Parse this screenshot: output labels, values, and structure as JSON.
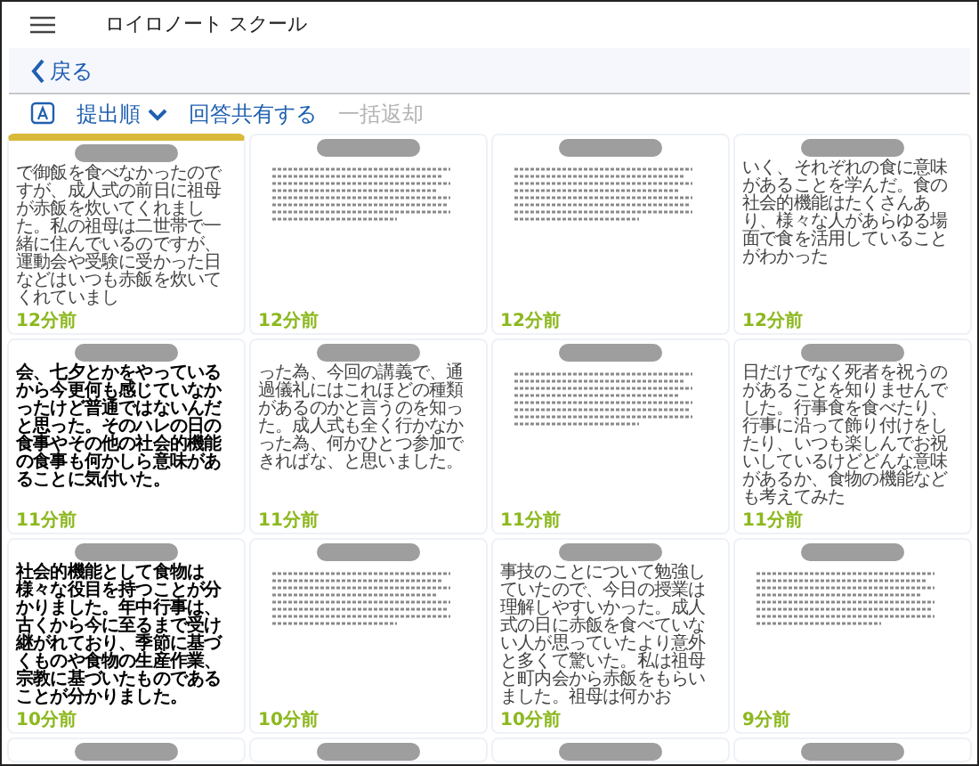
{
  "app_bar": {
    "title": "ロイロノート スクール"
  },
  "nav": {
    "back": "戻る"
  },
  "toolbar": {
    "sort": "提出順",
    "actions": [
      {
        "label": "回答共有する",
        "disabled": false
      },
      {
        "label": "一括返却",
        "disabled": true
      }
    ]
  },
  "cards": [
    {
      "kind": "text",
      "selected": true,
      "body": "で御飯を食べなかったのですが、成人式の前日に祖母が赤飯を炊いてくれました。私の祖母は二世帯で一緒に住んでいるのですが、運動会や受験に受かった日などはいつも赤飯を炊いてくれていまし",
      "time": "12分前"
    },
    {
      "kind": "thumbnail",
      "selected": false,
      "time": "12分前"
    },
    {
      "kind": "thumbnail",
      "selected": false,
      "time": "12分前"
    },
    {
      "kind": "text",
      "selected": false,
      "body": "いく、それぞれの食に意味があることを学んだ。食の社会的機能はたくさんあり、様々な人があらゆる場面で食を活用していることがわかった",
      "time": "12分前"
    },
    {
      "kind": "bold",
      "selected": false,
      "body": "会、七夕とかをやっているから今更何も感じていなかったけど普通ではないんだと思った。そのハレの日の食事やその他の社会的機能の食事も何かしら意味があることに気付いた。",
      "time": "11分前"
    },
    {
      "kind": "text",
      "selected": false,
      "body": "った為、今回の講義で、通過儀礼にはこれほどの種類があるのかと言うのを知った。成人式も全く行かなかった為、何かひとつ参加できればな、と思いました。",
      "time": "11分前"
    },
    {
      "kind": "thumbnail",
      "selected": false,
      "time": "11分前"
    },
    {
      "kind": "text",
      "selected": false,
      "body": "日だけでなく死者を祝うのがあることを知りませんでした。行事食を食べたり、行事に沿って飾り付けをしたり、いつも楽しんでお祝いしているけどどんな意味があるか、食物の機能なども考えてみた",
      "time": "11分前"
    },
    {
      "kind": "handwriting",
      "selected": false,
      "body": "社会的機能として食物は様々な役目を持つことが分かりました。年中行事は、古くから今に至るまで受け継がれており、季節に基づくものや食物の生産作業、宗教に基づいたものであることが分かりました。",
      "time": "10分前"
    },
    {
      "kind": "thumbnail",
      "selected": false,
      "time": "10分前"
    },
    {
      "kind": "text",
      "selected": false,
      "body": "事技のことについて勉強していたので、今日の授業は理解しやすいかった。成人式の日に赤飯を食べていない人が思っていたより意外と多くて驚いた。私は祖母と町内会から赤飯をもらいました。祖母は何かお",
      "time": "10分前"
    },
    {
      "kind": "thumbnail",
      "selected": false,
      "time": "9分前"
    },
    {
      "kind": "partial",
      "selected": false
    },
    {
      "kind": "partial",
      "selected": false
    },
    {
      "kind": "partial",
      "selected": false
    },
    {
      "kind": "partial",
      "selected": false
    }
  ]
}
